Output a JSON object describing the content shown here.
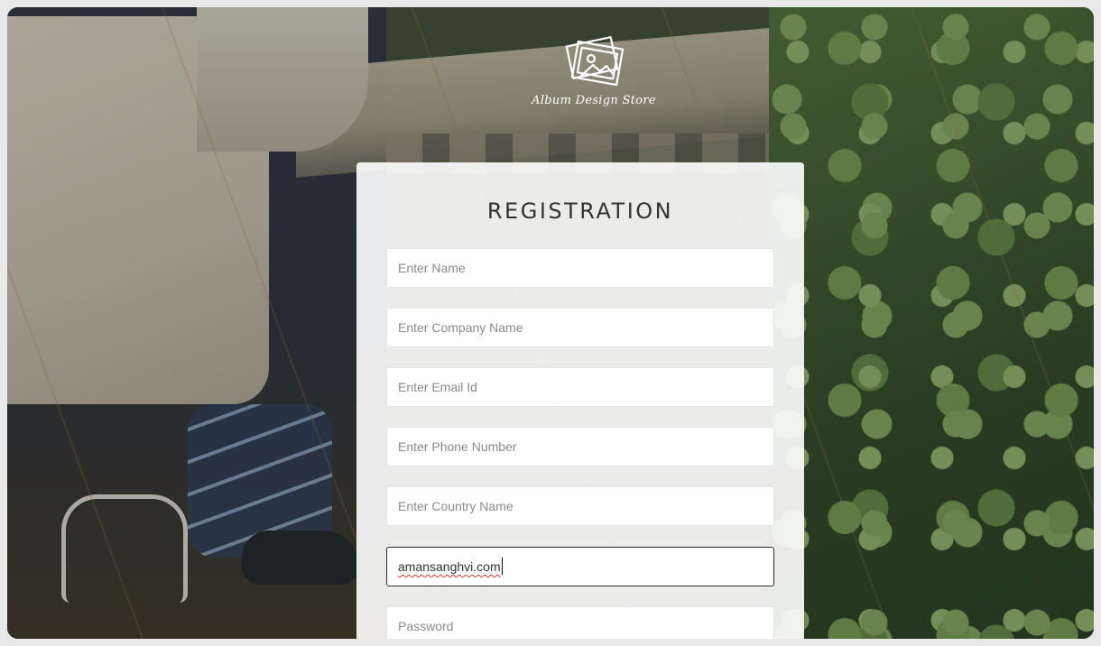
{
  "brand": {
    "logo_icon": "photo-frames-icon",
    "name": "Album Design Store"
  },
  "form": {
    "title": "REGISTRATION",
    "fields": [
      {
        "name": "name",
        "placeholder": "Enter Name",
        "value": ""
      },
      {
        "name": "company",
        "placeholder": "Enter Company Name",
        "value": ""
      },
      {
        "name": "email",
        "placeholder": "Enter Email Id",
        "value": ""
      },
      {
        "name": "phone",
        "placeholder": "Enter Phone Number",
        "value": ""
      },
      {
        "name": "country",
        "placeholder": "Enter Country Name",
        "value": ""
      },
      {
        "name": "username",
        "placeholder": "",
        "value": "amansanghvi.com"
      },
      {
        "name": "password",
        "placeholder": "Password",
        "value": ""
      }
    ]
  },
  "colors": {
    "card_bg": "#ffffff",
    "title_text": "#333333",
    "focus_border": "#2d2d2d",
    "spellcheck": "#dd3333"
  }
}
